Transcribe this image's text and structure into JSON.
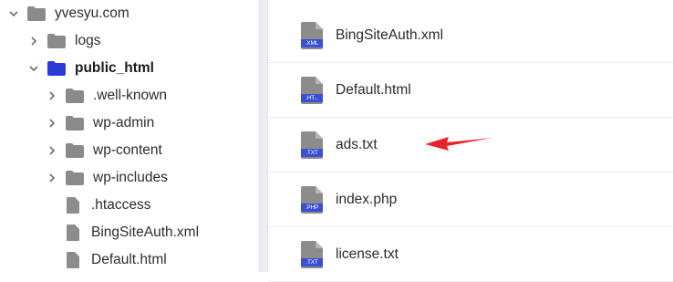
{
  "tree": {
    "items": [
      {
        "label": "yvesyu.com",
        "type": "folder",
        "expanded": true,
        "bold": false
      },
      {
        "label": "logs",
        "type": "folder",
        "expanded": false,
        "bold": false
      },
      {
        "label": "public_html",
        "type": "folder",
        "expanded": true,
        "bold": true
      },
      {
        "label": ".well-known",
        "type": "folder",
        "expanded": false,
        "bold": false
      },
      {
        "label": "wp-admin",
        "type": "folder",
        "expanded": false,
        "bold": false
      },
      {
        "label": "wp-content",
        "type": "folder",
        "expanded": false,
        "bold": false
      },
      {
        "label": "wp-includes",
        "type": "folder",
        "expanded": false,
        "bold": false
      },
      {
        "label": ".htaccess",
        "type": "file",
        "bold": false
      },
      {
        "label": "BingSiteAuth.xml",
        "type": "file",
        "bold": false
      },
      {
        "label": "Default.html",
        "type": "file",
        "bold": false
      }
    ]
  },
  "files": {
    "items": [
      {
        "name": "BingSiteAuth.xml",
        "ext": ".XML"
      },
      {
        "name": "Default.html",
        "ext": ".HT..."
      },
      {
        "name": "ads.txt",
        "ext": ".TXT"
      },
      {
        "name": "index.php",
        "ext": ".PHP"
      },
      {
        "name": "license.txt",
        "ext": ".TXT"
      }
    ]
  },
  "colors": {
    "folder_gray": "#8a8a8a",
    "folder_selected": "#2d3bd6",
    "file_gray": "#8c8c8c",
    "file_badge": "#3a4fd3",
    "arrow_red": "#e8242a"
  },
  "icons": {
    "chevron_right": "chevron-right-icon",
    "chevron_down": "chevron-down-icon",
    "folder": "folder-icon",
    "file": "file-icon"
  }
}
